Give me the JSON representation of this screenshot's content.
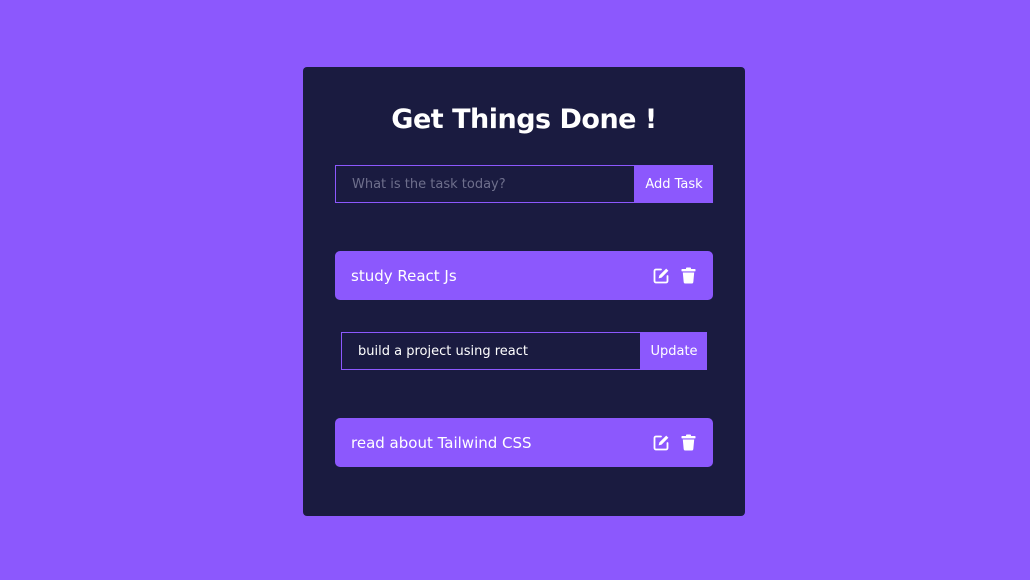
{
  "colors": {
    "background": "#8c58fd",
    "card": "#1a1b40",
    "accent": "#8c58fd",
    "text": "#ffffff",
    "placeholder": "#6e6f8c"
  },
  "app": {
    "title": "Get Things Done !"
  },
  "add_form": {
    "placeholder": "What is the task today?",
    "value": "",
    "button_label": "Add Task"
  },
  "todos": [
    {
      "text": "study React Js",
      "edit_icon": "edit-icon",
      "delete_icon": "trash-icon"
    },
    {
      "text": "read about Tailwind CSS",
      "edit_icon": "edit-icon",
      "delete_icon": "trash-icon"
    }
  ],
  "edit_form": {
    "value": "build a project using react",
    "button_label": "Update"
  }
}
